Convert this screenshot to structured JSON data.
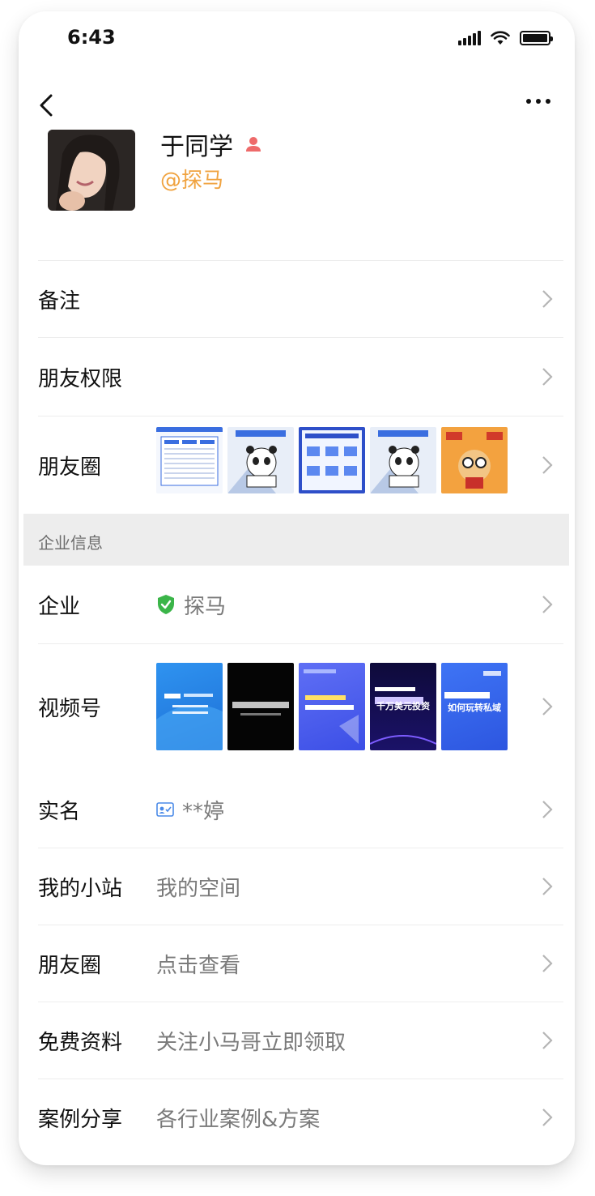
{
  "status_bar": {
    "time": "6:43"
  },
  "profile": {
    "name": "于同学",
    "company_handle": "@探马"
  },
  "rows": {
    "remark": {
      "label": "备注"
    },
    "friend_permission": {
      "label": "朋友权限"
    },
    "moments_gallery": {
      "label": "朋友圈"
    },
    "enterprise": {
      "label": "企业",
      "value": "探马"
    },
    "channels": {
      "label": "视频号"
    },
    "real_name": {
      "label": "实名",
      "value": "**婷"
    },
    "my_site": {
      "label": "我的小站",
      "value": "我的空间"
    },
    "moments_link": {
      "label": "朋友圈",
      "value": "点击查看"
    },
    "free_materials": {
      "label": "免费资料",
      "value": "关注小马哥立即领取"
    },
    "case_share": {
      "label": "案例分享",
      "value": "各行业案例&方案"
    }
  },
  "section_header": {
    "label": "企业信息"
  },
  "channel_thumbs": [
    {
      "caption": ""
    },
    {
      "caption": ""
    },
    {
      "caption": ""
    },
    {
      "caption": "千万美元投资"
    },
    {
      "caption": "如何玩转私域"
    }
  ],
  "colors": {
    "accent_orange": "#f0a340",
    "verified_green": "#3bb549",
    "person_badge": "#ee6a6a",
    "section_bg": "#ededed",
    "secondary_text": "#7a7a7a"
  },
  "icons": {
    "back": "chevron-left-icon",
    "more": "more-dots-icon",
    "chevron": "chevron-right-icon",
    "verified": "shield-check-icon",
    "real_name": "id-card-icon",
    "person": "person-icon"
  }
}
